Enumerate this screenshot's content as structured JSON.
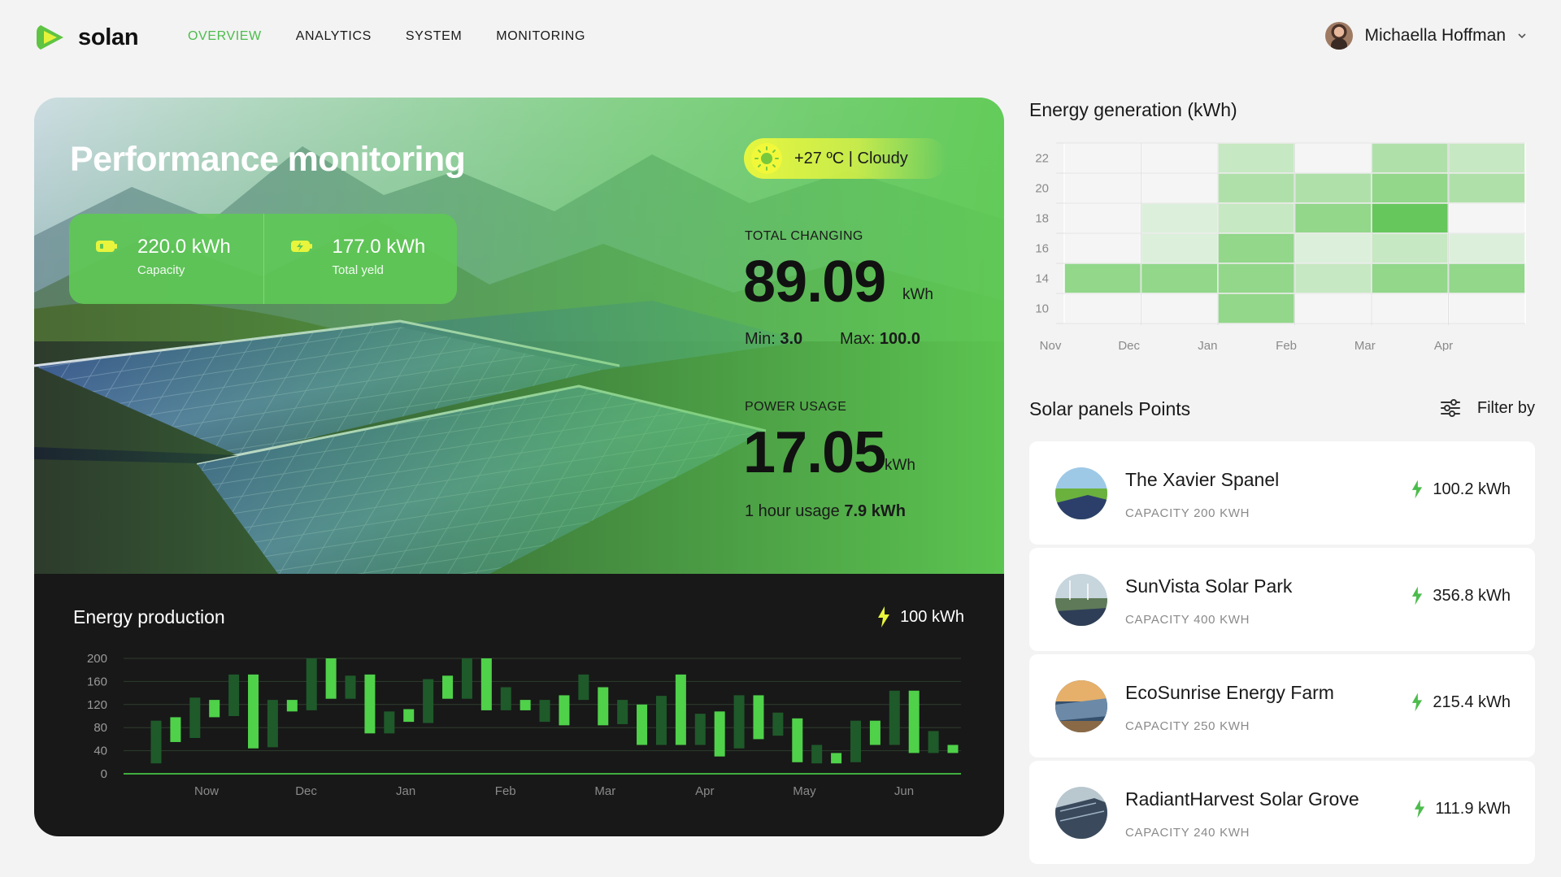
{
  "brand": {
    "name": "solan",
    "accent": "#4cbc4c"
  },
  "nav": [
    {
      "label": "OVERVIEW",
      "active": true
    },
    {
      "label": "ANALYTICS",
      "active": false
    },
    {
      "label": "SYSTEM",
      "active": false
    },
    {
      "label": "MONITORING",
      "active": false
    }
  ],
  "user": {
    "name": "Michaella Hoffman"
  },
  "hero": {
    "title": "Performance monitoring",
    "stats": [
      {
        "value": "220.0 kWh",
        "label": "Capacity",
        "icon": "battery-icon"
      },
      {
        "value": "177.0 kWh",
        "label": "Total yeld",
        "icon": "battery-charging-icon"
      }
    ],
    "weather": "+27 ºC  |  Cloudy",
    "total": {
      "label": "TOTAL CHANGING",
      "value": "89.09",
      "unit": "kWh",
      "min_label": "Min:",
      "min": "3.0",
      "max_label": "Max:",
      "max": "100.0"
    },
    "power": {
      "label": "POWER USAGE",
      "value": "17.05",
      "unit": "kWh",
      "hour_label": "1 hour usage",
      "hour_value": "7.9 kWh"
    }
  },
  "production": {
    "title": "Energy production",
    "badge": "100 kWh",
    "chart_data": {
      "type": "bar",
      "title": "Energy production",
      "ylim": [
        0,
        200
      ],
      "yticks": [
        200,
        160,
        120,
        80,
        40,
        0
      ],
      "xlabels": [
        "Now",
        "Dec",
        "Jan",
        "Feb",
        "Mar",
        "Apr",
        "May",
        "Jun"
      ],
      "grid": true,
      "bars": [
        {
          "low": 18,
          "high": 92,
          "tone": "dark"
        },
        {
          "low": 55,
          "high": 98,
          "tone": "light"
        },
        {
          "low": 62,
          "high": 132,
          "tone": "dark"
        },
        {
          "low": 98,
          "high": 128,
          "tone": "light"
        },
        {
          "low": 100,
          "high": 172,
          "tone": "dark"
        },
        {
          "low": 44,
          "high": 172,
          "tone": "light"
        },
        {
          "low": 46,
          "high": 128,
          "tone": "dark"
        },
        {
          "low": 108,
          "high": 128,
          "tone": "light"
        },
        {
          "low": 110,
          "high": 200,
          "tone": "dark"
        },
        {
          "low": 130,
          "high": 200,
          "tone": "light"
        },
        {
          "low": 130,
          "high": 170,
          "tone": "dark"
        },
        {
          "low": 70,
          "high": 172,
          "tone": "light"
        },
        {
          "low": 70,
          "high": 108,
          "tone": "dark"
        },
        {
          "low": 90,
          "high": 112,
          "tone": "light"
        },
        {
          "low": 88,
          "high": 164,
          "tone": "dark"
        },
        {
          "low": 130,
          "high": 170,
          "tone": "light"
        },
        {
          "low": 130,
          "high": 200,
          "tone": "dark"
        },
        {
          "low": 110,
          "high": 200,
          "tone": "light"
        },
        {
          "low": 110,
          "high": 150,
          "tone": "dark"
        },
        {
          "low": 110,
          "high": 128,
          "tone": "light"
        },
        {
          "low": 90,
          "high": 128,
          "tone": "dark"
        },
        {
          "low": 84,
          "high": 136,
          "tone": "light"
        },
        {
          "low": 128,
          "high": 172,
          "tone": "dark"
        },
        {
          "low": 84,
          "high": 150,
          "tone": "light"
        },
        {
          "low": 86,
          "high": 128,
          "tone": "dark"
        },
        {
          "low": 50,
          "high": 120,
          "tone": "light"
        },
        {
          "low": 50,
          "high": 135,
          "tone": "dark"
        },
        {
          "low": 50,
          "high": 172,
          "tone": "light"
        },
        {
          "low": 50,
          "high": 104,
          "tone": "dark"
        },
        {
          "low": 30,
          "high": 108,
          "tone": "light"
        },
        {
          "low": 44,
          "high": 136,
          "tone": "dark"
        },
        {
          "low": 60,
          "high": 136,
          "tone": "light"
        },
        {
          "low": 66,
          "high": 106,
          "tone": "dark"
        },
        {
          "low": 20,
          "high": 96,
          "tone": "light"
        },
        {
          "low": 18,
          "high": 50,
          "tone": "dark"
        },
        {
          "low": 18,
          "high": 36,
          "tone": "light"
        },
        {
          "low": 20,
          "high": 92,
          "tone": "dark"
        },
        {
          "low": 50,
          "high": 92,
          "tone": "light"
        },
        {
          "low": 50,
          "high": 144,
          "tone": "dark"
        },
        {
          "low": 36,
          "high": 144,
          "tone": "light"
        },
        {
          "low": 36,
          "high": 74,
          "tone": "dark"
        },
        {
          "low": 36,
          "high": 50,
          "tone": "light"
        }
      ]
    }
  },
  "generation": {
    "title": "Energy generation (kWh)",
    "chart_data": {
      "type": "heatmap",
      "title": "Energy generation (kWh)",
      "x": [
        "Nov",
        "Dec",
        "Jan",
        "Feb",
        "Mar",
        "Apr"
      ],
      "y": [
        22,
        20,
        18,
        16,
        14,
        10
      ],
      "values": [
        [
          0,
          0,
          2,
          0,
          3,
          2
        ],
        [
          0,
          0,
          3,
          3,
          4,
          3
        ],
        [
          0,
          1,
          2,
          4,
          6,
          0
        ],
        [
          0,
          1,
          4,
          1,
          2,
          1
        ],
        [
          4,
          4,
          4,
          2,
          4,
          4
        ],
        [
          0,
          0,
          4,
          0,
          0,
          0
        ]
      ],
      "colors": [
        "#f5f5f5",
        "#dcefdb",
        "#c6e8c2",
        "#b0e0aa",
        "#92d78a",
        "#79cf70",
        "#66c75c"
      ]
    }
  },
  "panels": {
    "title": "Solar panels Points",
    "filter_label": "Filter by",
    "items": [
      {
        "name": "The Xavier Spanel",
        "capacity": "CAPACITY 200 KWH",
        "value": "100.2 kWh"
      },
      {
        "name": "SunVista Solar Park",
        "capacity": "CAPACITY 400 KWH",
        "value": "356.8 kWh"
      },
      {
        "name": "EcoSunrise Energy Farm",
        "capacity": "CAPACITY 250 KWH",
        "value": "215.4 kWh"
      },
      {
        "name": "RadiantHarvest Solar Grove",
        "capacity": "CAPACITY 240 KWH",
        "value": "111.9 kWh"
      }
    ]
  }
}
